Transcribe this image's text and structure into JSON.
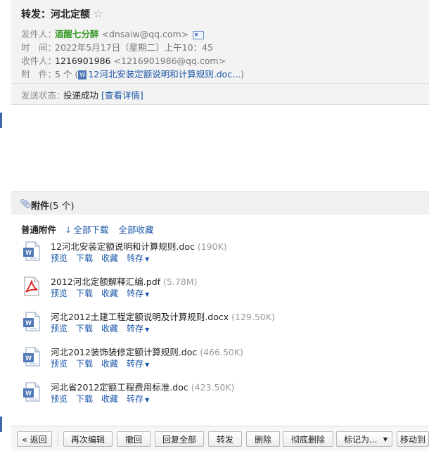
{
  "mail": {
    "subject": "转发：河北定额",
    "star": "☆",
    "from_label": "发件人：",
    "from_name": "酒醒七分醉",
    "from_addr": "<dnsaiw@qq.com>",
    "time_label": "时　间：",
    "time_value": "2022年5月17日（星期二）上午10：45",
    "to_label": "收件人：",
    "to_name": "1216901986",
    "to_addr": "<1216901986@qq.com>",
    "att_label": "附　件：",
    "att_count": "5 个",
    "att_open": "(",
    "att_first": "12河北安装定额说明和计算规则.doc...",
    "att_close": ")",
    "status_label": "发送状态：",
    "status_value": "投递成功",
    "status_link": "[查看详情]"
  },
  "attachments": {
    "title": "附件",
    "count": "(5 个)",
    "section": "普通附件",
    "download_all": "全部下载",
    "collect_all": "全部收藏",
    "files": [
      {
        "name": "12河北安装定额说明和计算规则.doc",
        "size": "(190K)",
        "type": "doc"
      },
      {
        "name": "2012河北定额解释汇编.pdf",
        "size": "(5.78M)",
        "type": "pdf"
      },
      {
        "name": "河北2012土建工程定额说明及计算规则.docx",
        "size": "(129.50K)",
        "type": "doc"
      },
      {
        "name": "河北2012装饰装修定额计算规则.doc",
        "size": "(466.50K)",
        "type": "doc"
      },
      {
        "name": "河北省2012定额工程费用标准.doc",
        "size": "(423.50K)",
        "type": "doc"
      }
    ],
    "actions": {
      "preview": "预览",
      "download": "下载",
      "collect": "收藏",
      "save": "转存"
    }
  },
  "toolbar": {
    "back": "« 返回",
    "reedit": "再次编辑",
    "recall": "撤回",
    "reply_all": "回复全部",
    "forward": "转发",
    "delete": "删除",
    "delete_perm": "彻底删除",
    "mark_as": "标记为...",
    "move_to": "移动到"
  },
  "colors": {
    "accent": "#1a56a8",
    "sender": "#3c9b2b",
    "header_bg": "#f3f3f3"
  }
}
